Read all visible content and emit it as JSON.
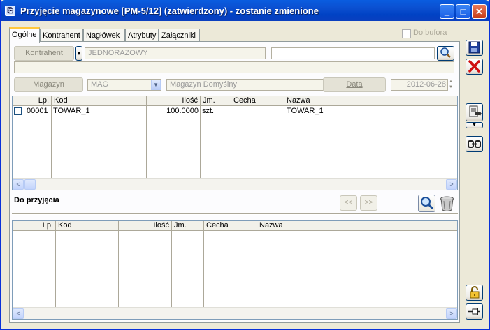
{
  "window": {
    "title": "Przyjęcie magazynowe [PM-5/12] (zatwierdzony) - zostanie zmienione",
    "minimize": "_",
    "maximize": "□",
    "close": "✕"
  },
  "tabs": [
    "Ogólne",
    "Kontrahent",
    "Nagłówek",
    "Atrybuty",
    "Załączniki"
  ],
  "do_bufora": "Do bufora",
  "kontrahent": {
    "button": "Kontrahent",
    "value": "JEDNORAZOWY",
    "value2": "",
    "address": ""
  },
  "magazyn": {
    "button": "Magazyn",
    "code": "MAG",
    "name": "Magazyn Domyślny"
  },
  "data": {
    "button": "Data",
    "value": "2012-06-28"
  },
  "items_grid": {
    "columns": [
      "Lp.",
      "Kod",
      "Ilość",
      "Jm.",
      "Cecha",
      "Nazwa"
    ],
    "rows": [
      {
        "lp": "00001",
        "kod": "TOWAR_1",
        "ilosc": "100.0000",
        "jm": "szt.",
        "cecha": "",
        "nazwa": "TOWAR_1"
      }
    ]
  },
  "do_przyjecia": {
    "label": "Do przyjęcia",
    "prev": "<<",
    "next": ">>",
    "columns": [
      "Lp.",
      "Kod",
      "Ilość",
      "Jm.",
      "Cecha",
      "Nazwa"
    ]
  },
  "icons": {
    "app": "document-icon",
    "search": "magnifier-icon",
    "trash": "trash-icon",
    "save": "floppy-disk-icon",
    "cancel": "red-x-icon",
    "process": "document-arrow-icon",
    "link": "chain-link-icon",
    "lock": "padlock-icon",
    "pin": "pin-icon"
  }
}
